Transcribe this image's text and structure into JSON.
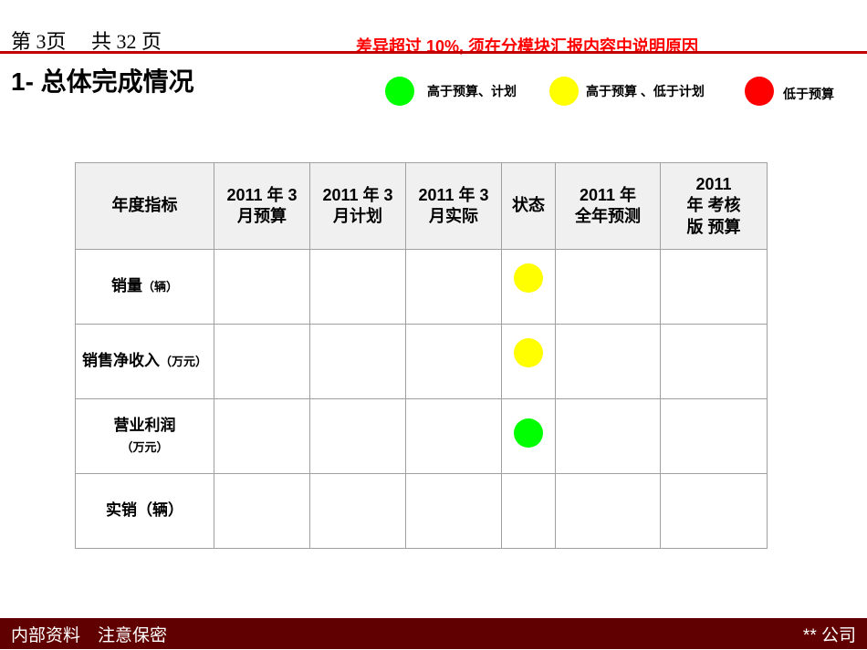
{
  "header": {
    "page": "第 3页　 共 32 页",
    "warning": "差异超过 10%, 须在分模块汇报内容中说明原因"
  },
  "title": "1-  总体完成情况",
  "legend": [
    {
      "label": "高于预算、计划",
      "color": "#00ff00"
    },
    {
      "label": "高于预算 、低于计划",
      "color": "#ffff00"
    },
    {
      "label": "低于预算",
      "color": "#ff0000"
    }
  ],
  "table": {
    "headers": [
      "年度指标",
      "2011 年 3 月预算",
      "2011 年 3 月计划",
      "2011 年 3 月实际",
      "状态",
      "2011 年 全年预测",
      "2011 年 考核版 预算"
    ],
    "rows": [
      {
        "label": "销量",
        "unit": "（辆）",
        "status_color": "#ffff00"
      },
      {
        "label": "销售净收入",
        "unit": "（万元）",
        "status_color": "#ffff00"
      },
      {
        "label": "营业利润",
        "unit": "（万元）",
        "status_color": "#00ff00"
      },
      {
        "label": "实销（辆）",
        "unit": "",
        "status_color": ""
      }
    ]
  },
  "footer": {
    "left": "内部资料　注意保密",
    "right": "** 公司"
  }
}
